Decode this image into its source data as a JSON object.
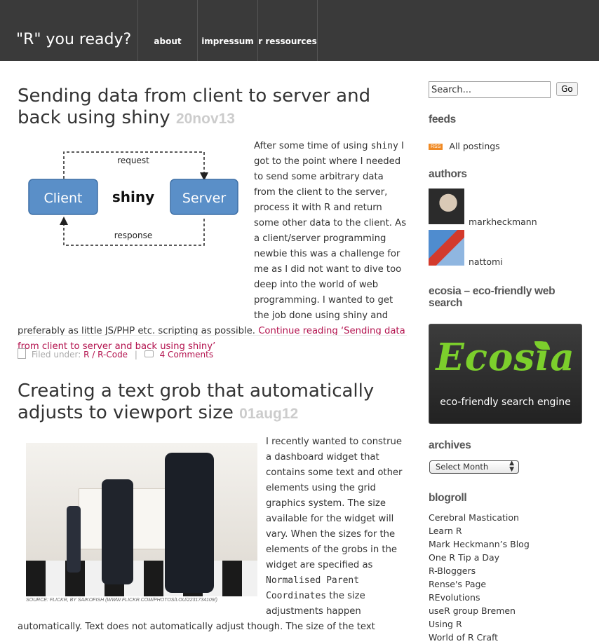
{
  "site": {
    "title": "\"R\" you ready?"
  },
  "nav": [
    {
      "label": "about"
    },
    {
      "label": "impressum"
    },
    {
      "label": "r ressources"
    }
  ],
  "posts": [
    {
      "title": "Sending data from client to server and back using shiny",
      "date": "20nov13",
      "diagram": {
        "request": "request",
        "response": "response",
        "client": "Client",
        "server": "Server",
        "center": "shiny"
      },
      "intro": "After some time of using",
      "code": "shiny",
      "body": "I got to the point where I needed to send some arbitrary data from the client to the server, process it with R and return some other data to the client. As a client/server programming newbie this was a challenge for me as I did not want to dive too deep into the world of web programming. I wanted to get the job done using shiny and preferably as little JS/PHP etc. scripting as possible.",
      "more": "Continue reading ‘Sending data from client to server and back using shiny’",
      "meta": {
        "filed_under": "Filed under:",
        "categories": "R / R-Code",
        "sep": "|",
        "comments": "4 Comments"
      }
    },
    {
      "title": "Creating a text grob that automatically adjusts to viewport size",
      "date": "01aug12",
      "caption": "SOURCE: FLICKR, BY SAIKOFISH (WWW.FLICKR.COM/PHOTOS/LOU/2231734109/)",
      "body1": "I recently wanted to construe a dashboard widget that contains some text and other elements using the grid graphics system. The size available for the widget will vary. When the sizes for the elements of the grobs in the widget are specified as",
      "code": "Normalised Parent Coordinates",
      "body2": "the size adjustments happen",
      "body3": "automatically. Text does not automatically adjust though. The size of the text"
    }
  ],
  "sidebar": {
    "search": {
      "placeholder": "Search...",
      "button": "Go"
    },
    "feeds": {
      "title": "feeds",
      "badge": "RSS",
      "link": "All postings"
    },
    "authors": {
      "title": "authors",
      "list": [
        {
          "name": "markheckmann"
        },
        {
          "name": "nattomi"
        }
      ]
    },
    "ecosia": {
      "title": "ecosia – eco-friendly web search",
      "logo": "Ecosia",
      "tagline": "eco-friendly search engine"
    },
    "archives": {
      "title": "archives",
      "select": "Select Month"
    },
    "blogroll": {
      "title": "blogroll",
      "links": [
        "Cerebral Mastication",
        "Learn R",
        "Mark Heckmann’s Blog",
        "One R Tip a Day",
        "R-Bloggers",
        "Rense's Page",
        "REvolutions",
        "useR group Bremen",
        "Using R",
        "World of R Craft"
      ]
    }
  },
  "colors": {
    "header_bg": "#3a3a3a",
    "link": "#b3124e",
    "date": "#cccccc",
    "diagram_box": "#5a8fc8"
  }
}
